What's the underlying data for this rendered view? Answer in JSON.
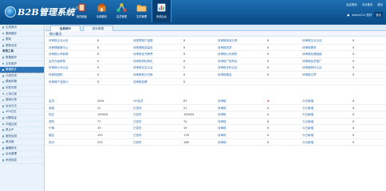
{
  "header": {
    "logo_text": "B2B管理系统",
    "logo_tm": "TM",
    "modules": [
      {
        "label": "我的面板",
        "icon": "book-icon"
      },
      {
        "label": "功能模块",
        "icon": "building-icon"
      },
      {
        "label": "会员管理",
        "icon": "network-icon"
      },
      {
        "label": "文件管理",
        "icon": "folder-icon"
      },
      {
        "label": "系统后台",
        "icon": "chart-icon",
        "active": true
      }
    ],
    "links": [
      "站点首页",
      "平台首页",
      "退出"
    ],
    "user": "admin111 您好",
    "logout": "退出"
  },
  "sidebar": {
    "items": [
      {
        "label": "生成首页"
      },
      {
        "label": "更新缓存"
      },
      {
        "label": "更新"
      },
      {
        "label": "更新全站"
      },
      {
        "label": "系统工具",
        "group": true
      },
      {
        "label": "数据维护"
      },
      {
        "label": "文件维护"
      },
      {
        "label": "数据统计",
        "active": true
      },
      {
        "label": "计划任务"
      },
      {
        "label": "模板风格"
      },
      {
        "label": "标签向导"
      },
      {
        "label": "上传记录"
      },
      {
        "label": "搜索记录"
      },
      {
        "label": "后台日志"
      },
      {
        "label": "404日志"
      },
      {
        "label": "问题验证"
      },
      {
        "label": "词语过滤"
      },
      {
        "label": "禁止IP"
      },
      {
        "label": "服务检测"
      },
      {
        "label": "单页面"
      },
      {
        "label": "编辑助手"
      },
      {
        "label": "后台管理"
      },
      {
        "label": "系统信息"
      }
    ]
  },
  "tabs": [
    {
      "label": "信息统计",
      "active": true
    },
    {
      "label": "统计报表",
      "active": false
    }
  ],
  "section_title": "统计概况",
  "stats_rows": [
    [
      [
        "待审核企业大全",
        "0"
      ],
      [
        "待受理用户金额",
        "0"
      ],
      [
        "待审核商品分类",
        "0"
      ],
      [
        "待审核企业认证",
        "0"
      ]
    ],
    [
      [
        "待受理客服中心",
        "0"
      ],
      [
        "待受理网站留言",
        "0"
      ],
      [
        "待审核供求",
        "0"
      ],
      [
        "待审核需求",
        "0"
      ]
    ],
    [
      [
        "待审核公司新闻",
        "0"
      ],
      [
        "待审核证书荣誉",
        "0"
      ],
      [
        "待审核公司资料",
        "0"
      ],
      [
        "待审核友情链接",
        "0"
      ]
    ],
    [
      [
        "会员升级审核",
        "0"
      ],
      [
        "待审核资料核实",
        "0"
      ],
      [
        "待审核广告购买",
        "0"
      ],
      [
        "待审核会员推广",
        "0"
      ]
    ],
    [
      [
        "待审核公司认证",
        "0"
      ],
      [
        "待审核实名认证",
        "0"
      ],
      [
        "待审核手机认证",
        "0"
      ],
      [
        "待审核邮件认证",
        "0"
      ]
    ],
    [
      [
        "待审核团购",
        "0"
      ],
      [
        "待审核积分兑换",
        "0"
      ],
      [
        "待审核展会",
        "0"
      ],
      [
        "待审核文章",
        "0"
      ]
    ],
    [
      [
        "待审核产品统计",
        "0"
      ],
      [
        "待审核品牌",
        "0"
      ],
      [
        "",
        ""
      ],
      [
        "",
        ""
      ]
    ]
  ],
  "totals_rows": [
    [
      [
        "会员",
        "4351"
      ],
      [
        "VIP会员",
        "87"
      ],
      [
        "待审核",
        "2"
      ],
      [
        "今日新增",
        "0"
      ]
    ],
    [
      [
        "商城",
        "21"
      ],
      [
        "已发布",
        "21"
      ],
      [
        "待审核",
        "0"
      ],
      [
        "今日新增",
        "0"
      ]
    ],
    [
      [
        "供应",
        "159425"
      ],
      [
        "已发布",
        "159425"
      ],
      [
        "待审核",
        "0"
      ],
      [
        "今日新增",
        "0"
      ]
    ],
    [
      [
        "求购",
        "77"
      ],
      [
        "已发布",
        "74"
      ],
      [
        "待审核",
        "0"
      ],
      [
        "今日新增",
        "0"
      ]
    ],
    [
      [
        "行情",
        "19"
      ],
      [
        "已发布",
        "19"
      ],
      [
        "待审核",
        "0"
      ],
      [
        "今日新增",
        "0"
      ]
    ],
    [
      [
        "展会",
        "193"
      ],
      [
        "已发布",
        "176"
      ],
      [
        "待审核",
        "0"
      ],
      [
        "今日新增",
        "0"
      ]
    ],
    [
      [
        "资讯",
        "293"
      ],
      [
        "已发布",
        "168"
      ],
      [
        "待审核",
        "0"
      ],
      [
        "今日新增",
        "0"
      ]
    ]
  ]
}
